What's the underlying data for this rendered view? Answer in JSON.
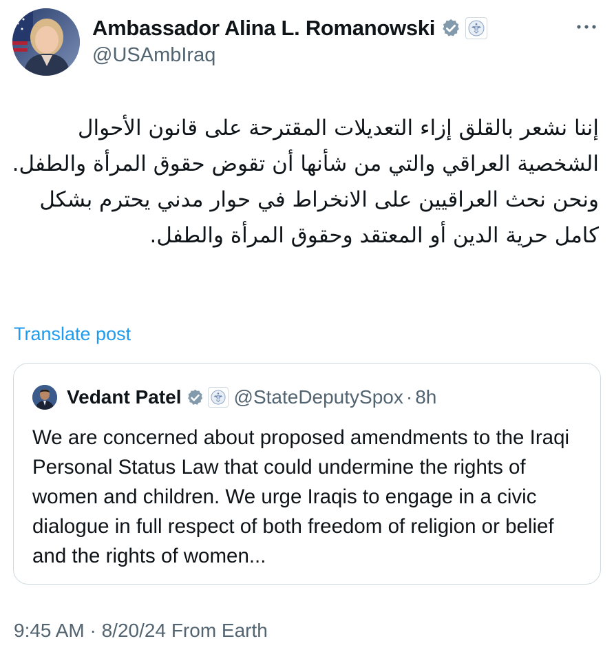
{
  "author": {
    "display_name": "Ambassador Alina L. Romanowski",
    "handle": "@USAmbIraq",
    "verified_icon": "verified-badge-icon",
    "affiliation_icon": "us-state-department-seal-icon"
  },
  "post": {
    "text_arabic": "إننا نشعر بالقلق إزاء التعديلات المقترحة على قانون الأحوال الشخصية العراقي والتي من شأنها أن تقوض حقوق المرأة والطفل. ونحن نحث العراقيين على الانخراط في حوار مدني يحترم بشكل كامل حرية الدين أو المعتقد وحقوق المرأة والطفل.",
    "translate_label": "Translate post",
    "timestamp": "9:45 AM · 8/20/24 From Earth"
  },
  "quoted_post": {
    "display_name": "Vedant Patel",
    "handle": "@StateDeputySpox",
    "separator": "·",
    "age": "8h",
    "text": "We are concerned about proposed amendments to the Iraqi Personal Status Law that could undermine the rights of women and children. We urge Iraqis to engage in a civic dialogue in full respect of both freedom of religion or belief and the rights of women..."
  },
  "colors": {
    "text_primary": "#0f1419",
    "text_secondary": "#536471",
    "link": "#1d9bf0",
    "border": "#cfd9de",
    "verified_grey": "#829aab"
  },
  "icons": {
    "more": "more-options-icon",
    "avatar": "author-avatar",
    "quoted_avatar": "quoted-author-avatar"
  }
}
